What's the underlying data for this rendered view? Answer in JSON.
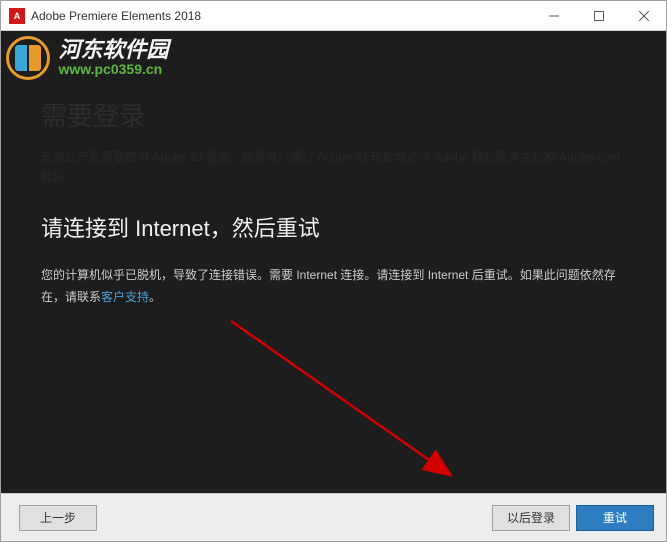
{
  "titlebar": {
    "app_icon_text": "A",
    "title": "Adobe Premiere Elements 2018"
  },
  "background": {
    "heading": "需要登录",
    "text": "安装此产品需要您用 Adobe ID 登录。登录可以通过 Adobe ID 轻松地访问 Adobe 联机服务主机和 Adobe.com 社区。"
  },
  "error": {
    "heading": "请连接到 Internet，然后重试",
    "text_prefix": "您的计算机似乎已脱机，导致了连接错误。需要 Internet 连接。请连接到 Internet 后重试。如果此问题依然存在，请联系",
    "link": "客户支持",
    "text_suffix": "。"
  },
  "footer": {
    "back": "上一步",
    "later": "以后登录",
    "retry": "重试"
  },
  "watermark": {
    "zh": "河东软件园",
    "url": "www.pc0359.cn"
  }
}
